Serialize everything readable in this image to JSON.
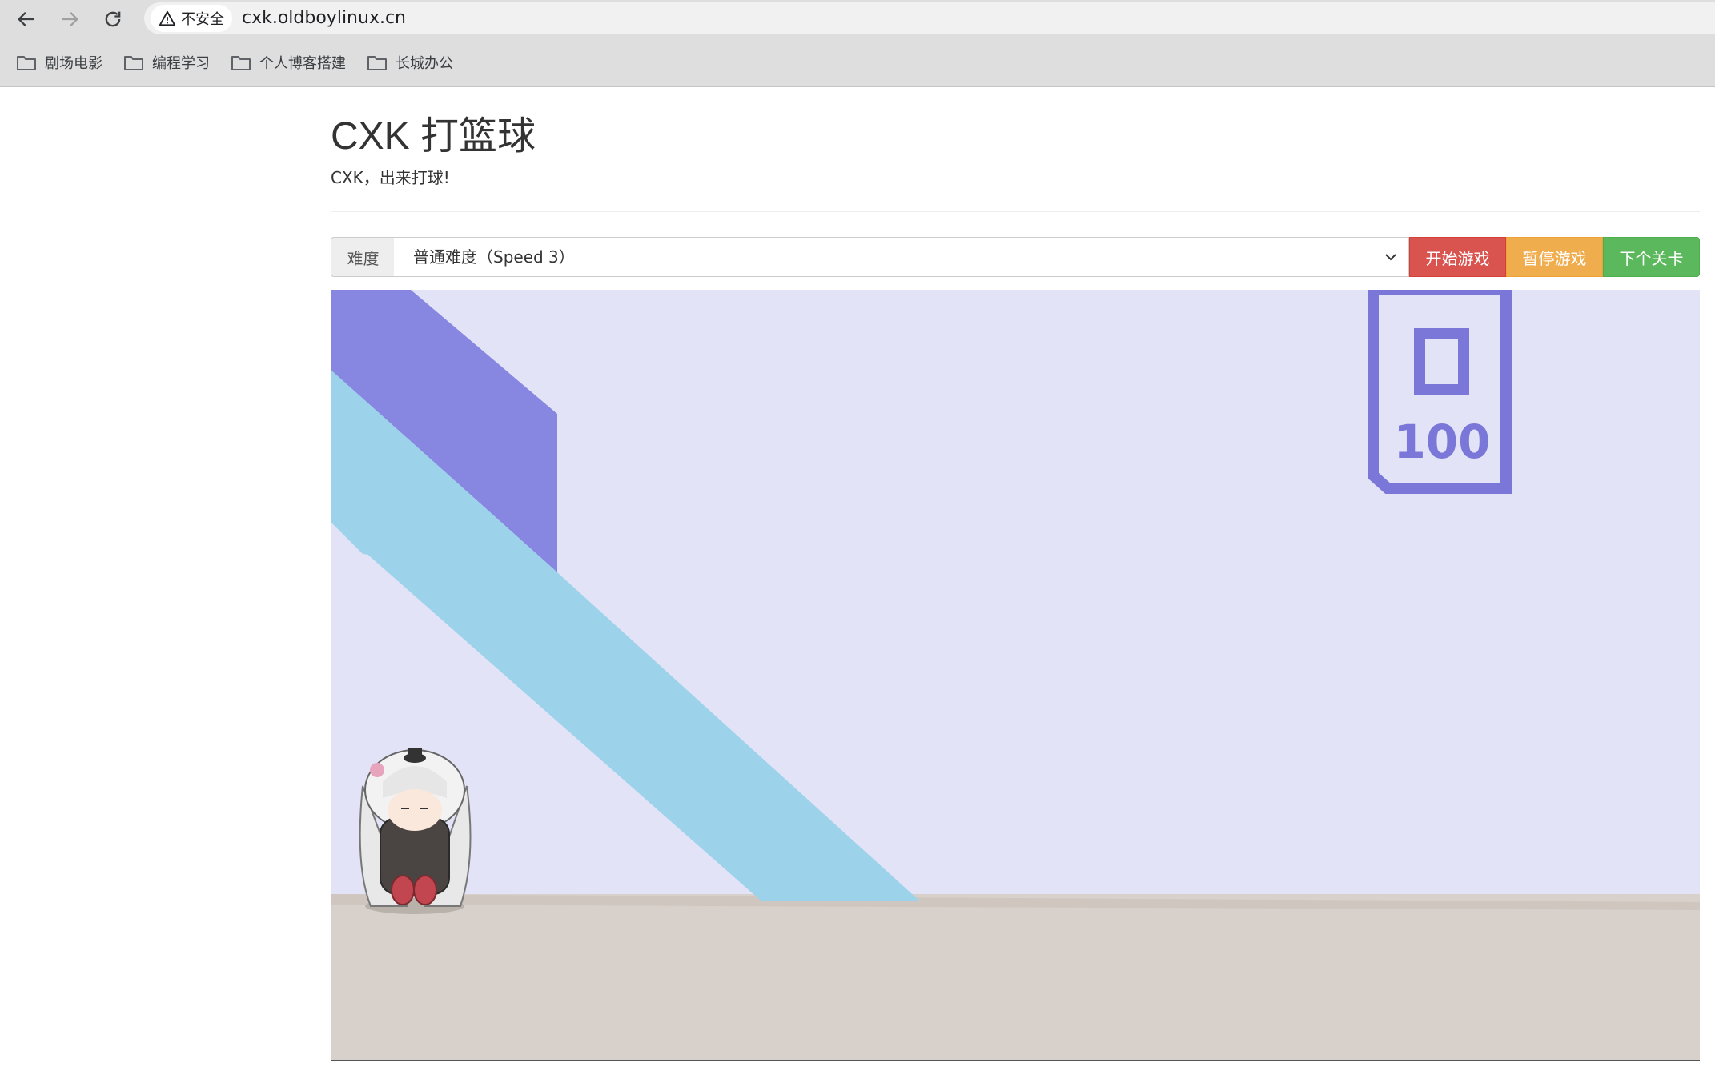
{
  "browser": {
    "security_label": "不安全",
    "url": "cxk.oldboylinux.cn",
    "bookmarks": [
      {
        "label": "剧场电影",
        "icon": "folder-icon"
      },
      {
        "label": "编程学习",
        "icon": "folder-icon"
      },
      {
        "label": "个人博客搭建",
        "icon": "folder-icon"
      },
      {
        "label": "长城办公",
        "icon": "folder-icon"
      }
    ]
  },
  "page": {
    "title": "CXK 打篮球",
    "subtitle": "CXK，出来打球!"
  },
  "controls": {
    "difficulty_label": "难度",
    "difficulty_value": "普通难度（Speed 3）",
    "start_label": "开始游戏",
    "pause_label": "暂停游戏",
    "next_label": "下个关卡"
  },
  "game": {
    "logo_text": "100"
  },
  "colors": {
    "start": "#d9534f",
    "pause": "#f0ad4e",
    "next": "#5cb85c",
    "wall": "#e2e3f7",
    "floor": "#d8d1cb",
    "stripe_purple": "#8786e0",
    "stripe_blue": "#9dd3ea",
    "logo": "#7a77d8"
  }
}
